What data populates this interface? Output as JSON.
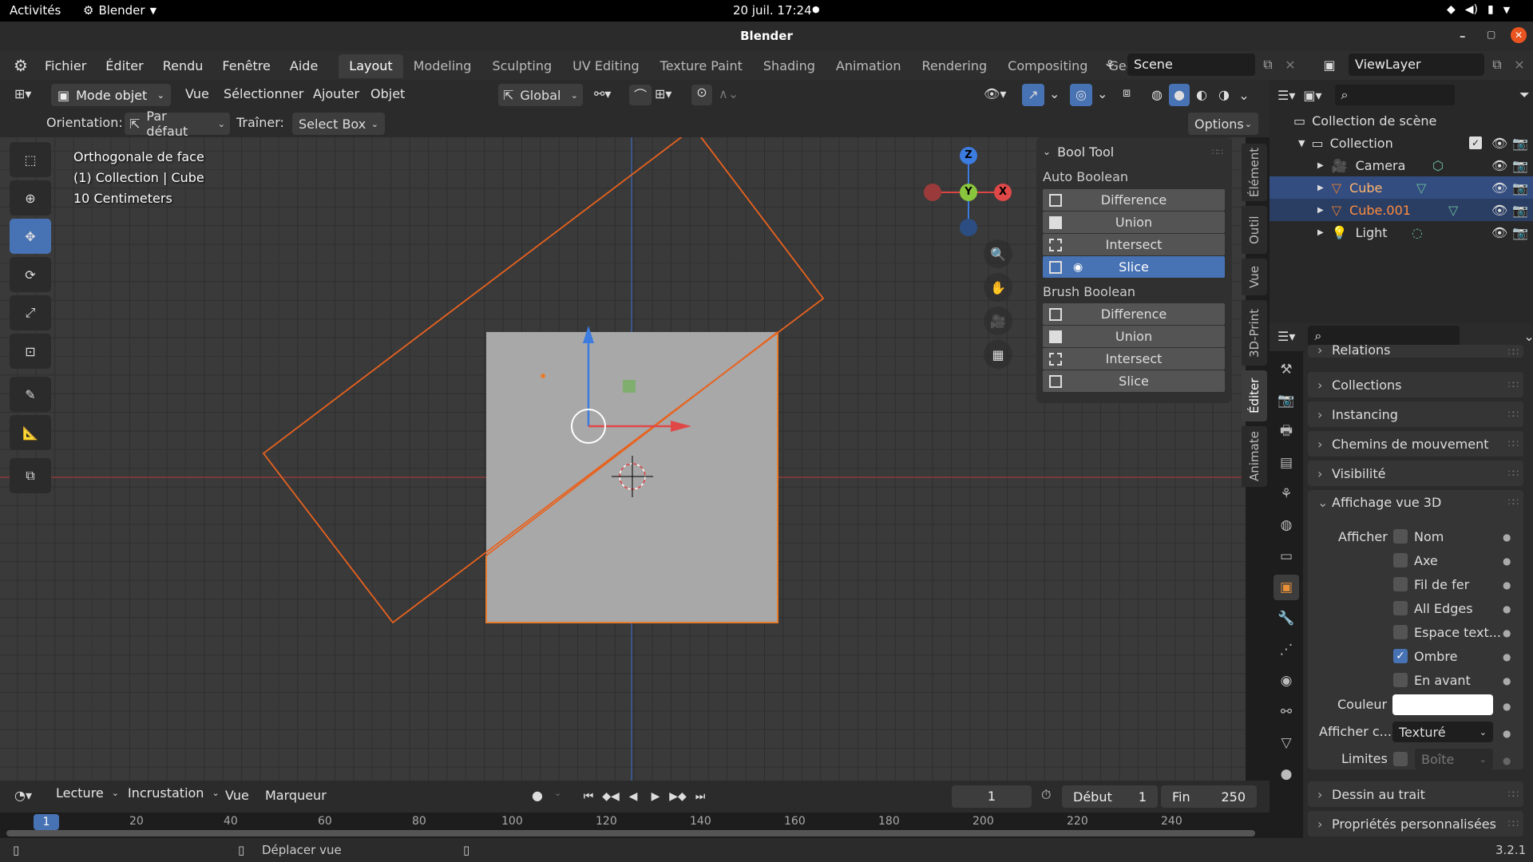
{
  "system_bar": {
    "activities": "Activités",
    "app_menu": "Blender",
    "clock": "20 juil.  17:24"
  },
  "window": {
    "title": "Blender"
  },
  "menu": {
    "items": [
      "Fichier",
      "Éditer",
      "Rendu",
      "Fenêtre",
      "Aide"
    ]
  },
  "workspaces": [
    "Layout",
    "Modeling",
    "Sculpting",
    "UV Editing",
    "Texture Paint",
    "Shading",
    "Animation",
    "Rendering",
    "Compositing",
    "Geomet"
  ],
  "scene": {
    "name": "Scene",
    "view_layer": "ViewLayer"
  },
  "viewport_header": {
    "mode": "Mode objet",
    "menus": [
      "Vue",
      "Sélectionner",
      "Ajouter",
      "Objet"
    ],
    "transform_orientation": "Global"
  },
  "tool_settings": {
    "orientation_label": "Orientation:",
    "orientation_value": "Par défaut",
    "drag_label": "Traîner:",
    "drag_value": "Select Box",
    "options": "Options"
  },
  "viewport_info": {
    "line1": "Orthogonale de face",
    "line2": "(1) Collection | Cube",
    "line3": "10 Centimeters"
  },
  "gizmo": {
    "z": "Z",
    "y": "Y",
    "x": "X"
  },
  "bool_tool": {
    "title": "Bool Tool",
    "auto_label": "Auto Boolean",
    "auto": [
      "Difference",
      "Union",
      "Intersect",
      "Slice"
    ],
    "brush_label": "Brush Boolean",
    "brush": [
      "Difference",
      "Union",
      "Intersect",
      "Slice"
    ]
  },
  "side_tabs": [
    "Élément",
    "Outil",
    "Vue",
    "3D-Print",
    "Éditer",
    "Animate"
  ],
  "outliner": {
    "scene_collection": "Collection de scène",
    "collection": "Collection",
    "objects": [
      "Camera",
      "Cube",
      "Cube.001",
      "Light"
    ]
  },
  "properties": {
    "sections_top": [
      "Relations",
      "Collections",
      "Instancing",
      "Chemins de mouvement",
      "Visibilité"
    ],
    "open_section": "Affichage vue 3D",
    "afficher_label": "Afficher",
    "checks": [
      {
        "label": "Nom",
        "on": false
      },
      {
        "label": "Axe",
        "on": false
      },
      {
        "label": "Fil de fer",
        "on": false
      },
      {
        "label": "All Edges",
        "on": false
      },
      {
        "label": "Espace text...",
        "on": false
      },
      {
        "label": "Ombre",
        "on": true
      },
      {
        "label": "En avant",
        "on": false
      }
    ],
    "color_label": "Couleur",
    "display_as_label": "Afficher c...",
    "display_as_value": "Texturé",
    "bounds_label": "Limites",
    "bounds_value": "Boîte",
    "sections_bottom": [
      "Dessin au trait",
      "Propriétés personnalisées"
    ]
  },
  "timeline": {
    "playback": "Lecture",
    "keying": "Incrustation",
    "view": "Vue",
    "marker": "Marqueur",
    "current_frame": "1",
    "start_label": "Début",
    "start": "1",
    "end_label": "Fin",
    "end": "250"
  },
  "ruler_ticks": [
    "20",
    "40",
    "60",
    "80",
    "100",
    "120",
    "140",
    "160",
    "180",
    "200",
    "220",
    "240"
  ],
  "ruler_current": "1",
  "status": {
    "hint": "Déplacer vue",
    "version": "3.2.1"
  }
}
